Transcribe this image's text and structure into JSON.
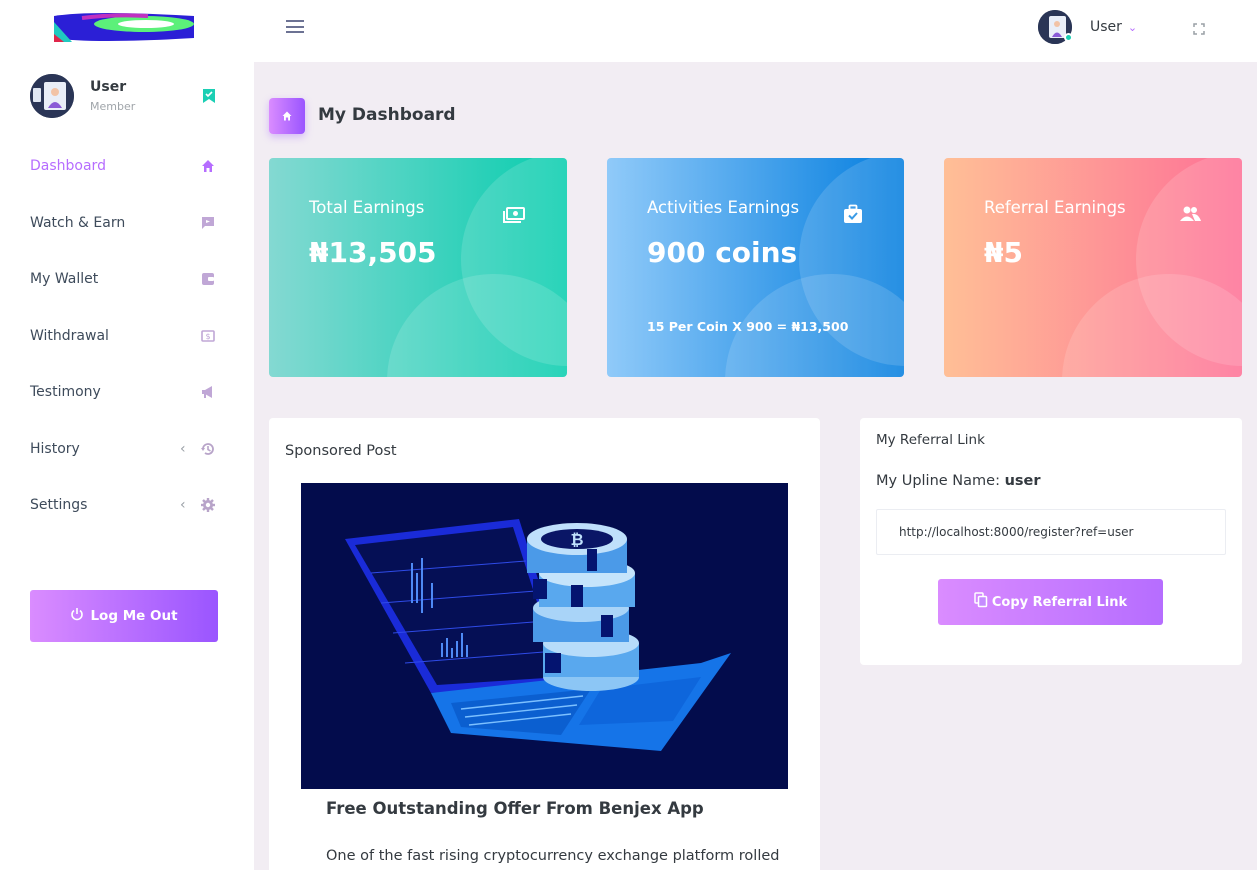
{
  "sidebar": {
    "logo": "logo",
    "profile": {
      "name": "User",
      "role": "Member"
    },
    "items": [
      {
        "label": "Dashboard",
        "icon": "home-icon",
        "active": true
      },
      {
        "label": "Watch & Earn",
        "icon": "video-message-icon"
      },
      {
        "label": "My Wallet",
        "icon": "wallet-icon"
      },
      {
        "label": "Withdrawal",
        "icon": "cash-icon"
      },
      {
        "label": "Testimony",
        "icon": "bullhorn-icon"
      },
      {
        "label": "History",
        "icon": "history-icon",
        "has_submenu": true
      },
      {
        "label": "Settings",
        "icon": "gear-icon",
        "has_submenu": true
      }
    ],
    "logout_label": "Log Me Out"
  },
  "topbar": {
    "user_name": "User"
  },
  "page": {
    "title": "My Dashboard"
  },
  "stats": [
    {
      "label": "Total Earnings",
      "value": "₦13,505",
      "note": "",
      "icon": "money-icon"
    },
    {
      "label": "Activities Earnings",
      "value": "900 coins",
      "note": "15 Per Coin X 900 = ₦13,500",
      "icon": "briefcase-check-icon"
    },
    {
      "label": "Referral Earnings",
      "value": "₦5",
      "note": "",
      "icon": "users-icon"
    }
  ],
  "sponsored": {
    "title": "Sponsored Post",
    "heading": "Free Outstanding Offer From Benjex App",
    "body": "One of the fast rising cryptocurrency exchange platform rolled"
  },
  "referral": {
    "title": "My Referral Link",
    "upline_label": "My Upline Name: ",
    "upline_value": "user",
    "link": "http://localhost:8000/register?ref=user",
    "copy_label": "Copy Referral Link"
  },
  "colors": {
    "accent": "#b66dff",
    "success": "#1bcfb4",
    "card_green": "#07cdae",
    "card_blue": "#047edf",
    "card_red": "#fe7096"
  }
}
